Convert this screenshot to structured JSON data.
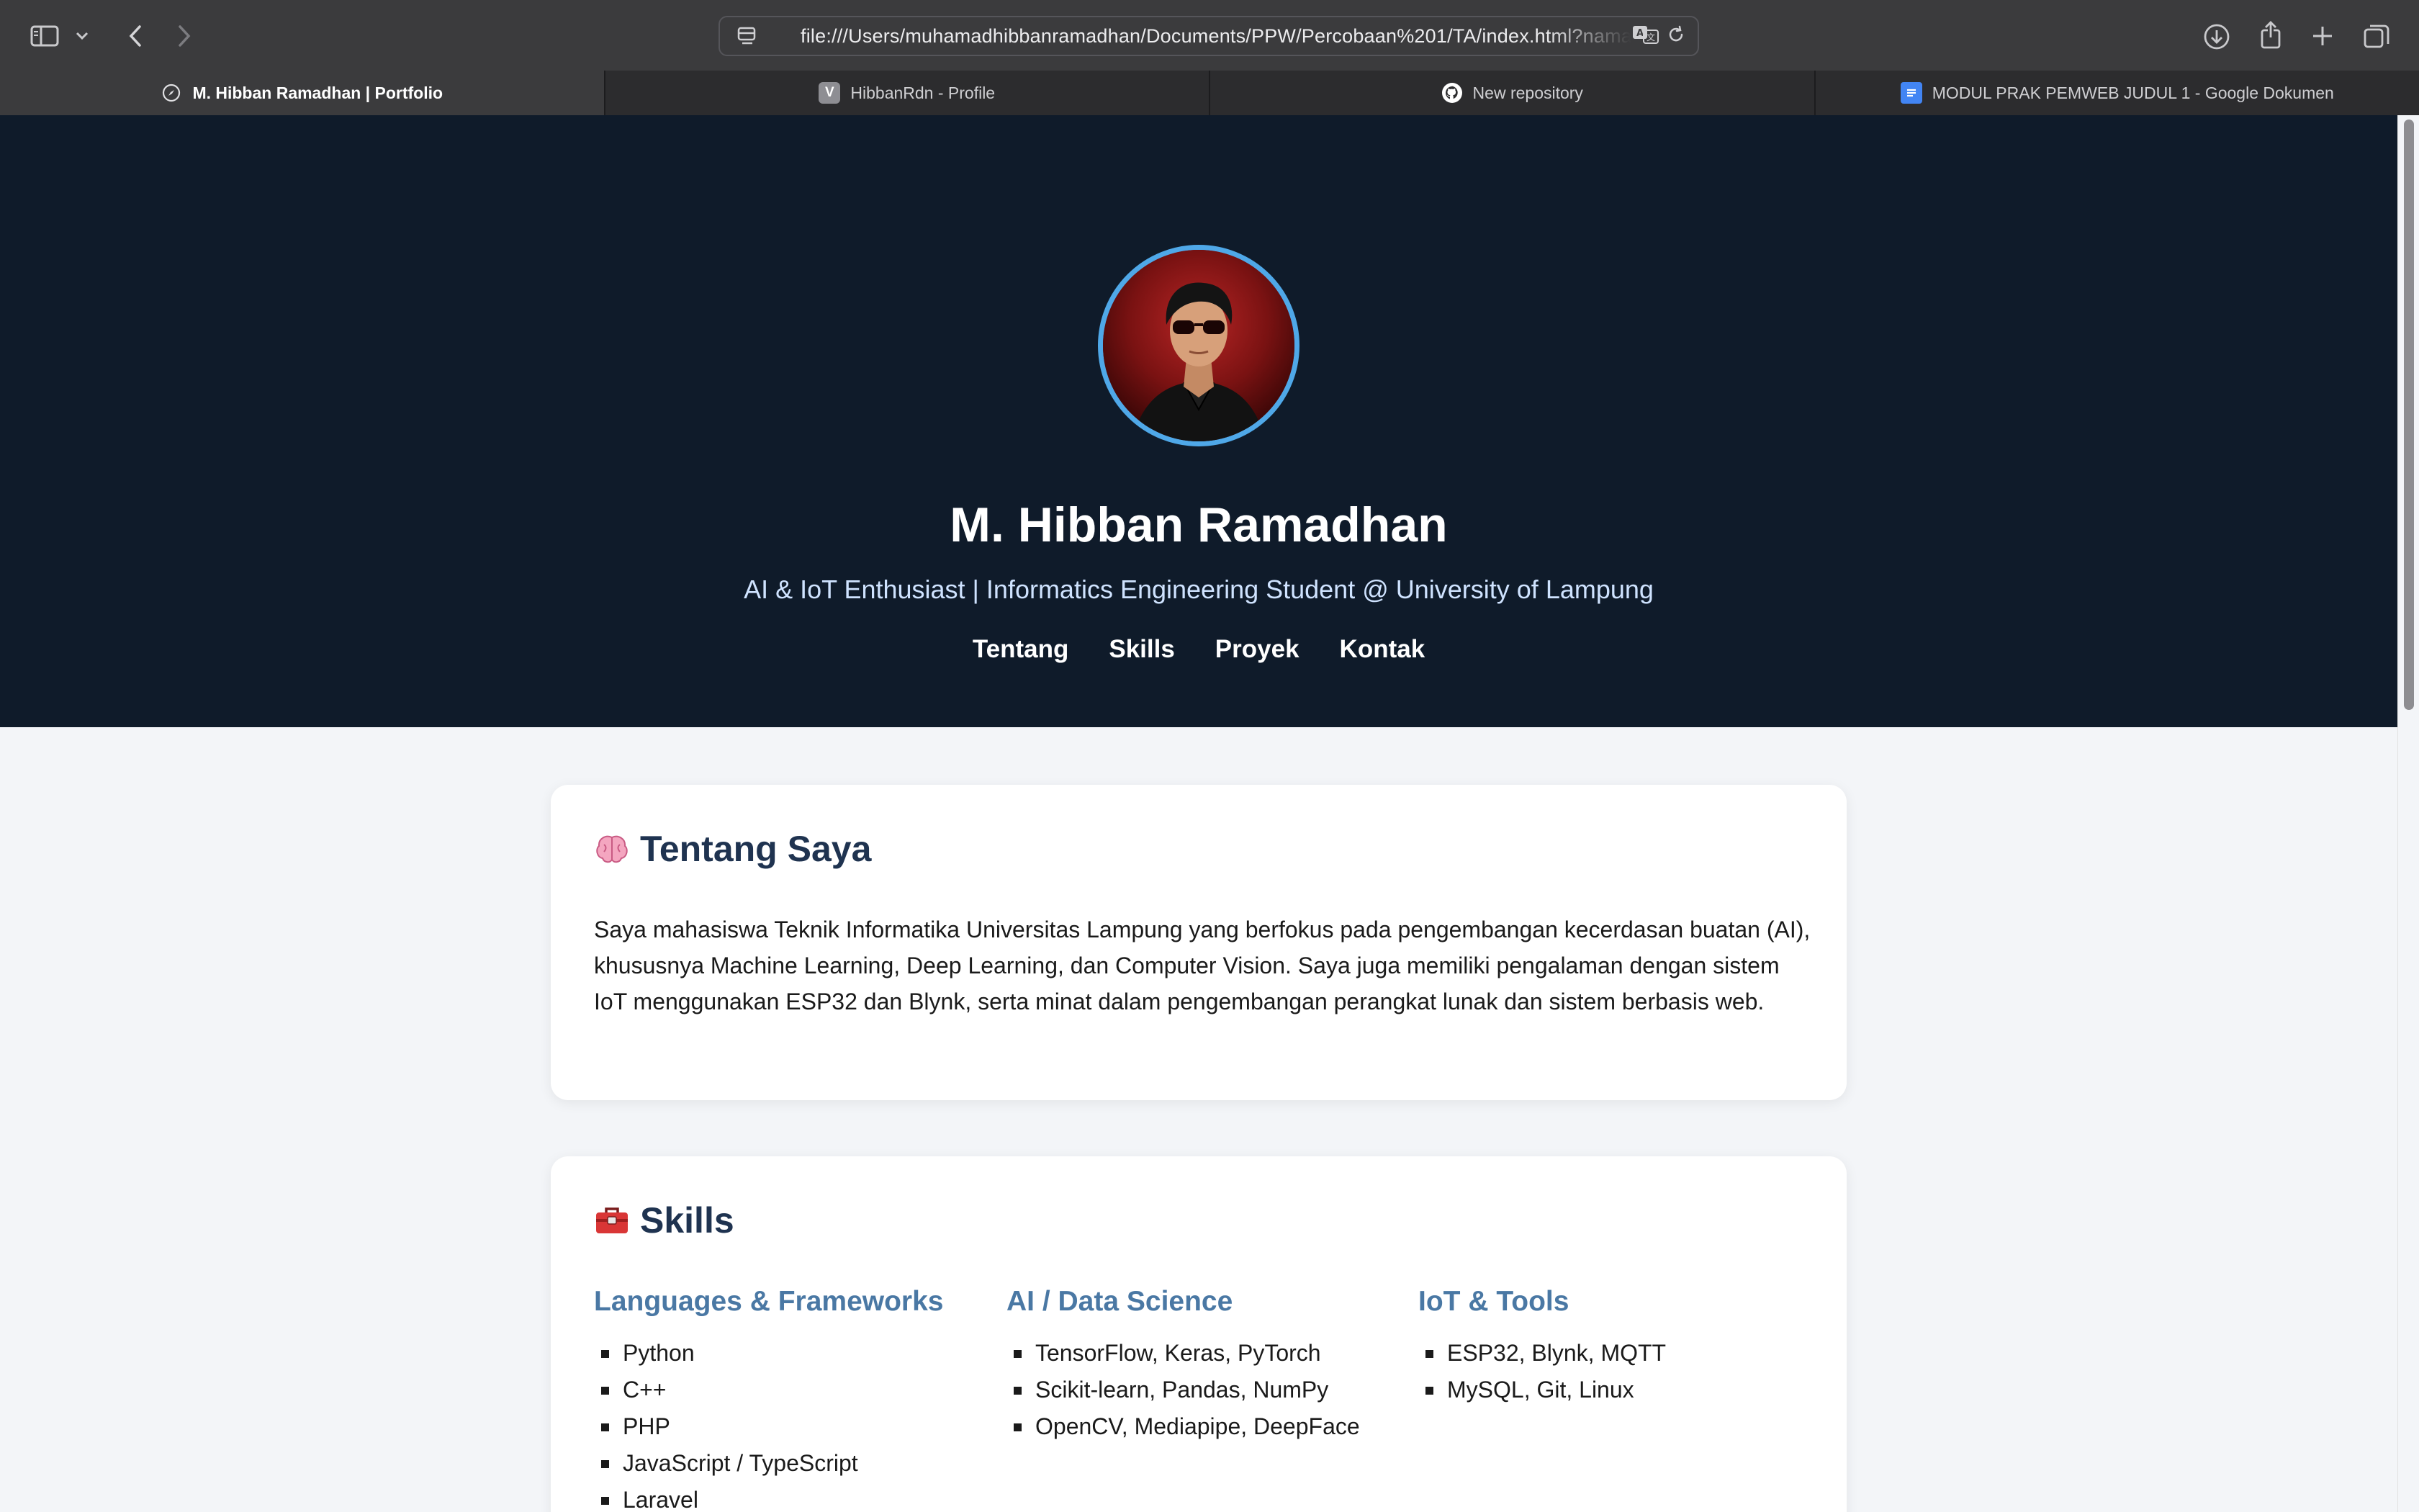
{
  "browser": {
    "url": "file:///Users/muhamadhibbanramadhan/Documents/PPW/Percobaan%201/TA/index.html?nama=",
    "tabs": [
      {
        "title": "M. Hibban Ramadhan | Portfolio",
        "icon": "compass-icon"
      },
      {
        "title": "HibbanRdn - Profile",
        "icon": "v-favicon",
        "favicon_letter": "V"
      },
      {
        "title": "New repository",
        "icon": "github-icon"
      },
      {
        "title": "MODUL PRAK PEMWEB JUDUL 1 - Google Dokumen",
        "icon": "google-docs-icon"
      }
    ]
  },
  "hero": {
    "name": "M. Hibban Ramadhan",
    "tagline": "AI & IoT Enthusiast | Informatics Engineering Student @ University of Lampung",
    "nav": [
      "Tentang",
      "Skills",
      "Proyek",
      "Kontak"
    ]
  },
  "about": {
    "title": "Tentang Saya",
    "icon": "brain-icon",
    "text": "Saya mahasiswa Teknik Informatika Universitas Lampung yang berfokus pada pengembangan kecerdasan buatan (AI), khususnya Machine Learning, Deep Learning, dan Computer Vision. Saya juga memiliki pengalaman dengan sistem IoT menggunakan ESP32 dan Blynk, serta minat dalam pengembangan perangkat lunak dan sistem berbasis web."
  },
  "skills": {
    "title": "Skills",
    "icon": "toolbox-icon",
    "columns": [
      {
        "heading": "Languages & Frameworks",
        "items": [
          "Python",
          "C++",
          "PHP",
          "JavaScript / TypeScript",
          "Laravel"
        ]
      },
      {
        "heading": "AI / Data Science",
        "items": [
          "TensorFlow, Keras, PyTorch",
          "Scikit-learn, Pandas, NumPy",
          "OpenCV, Mediapipe, DeepFace"
        ]
      },
      {
        "heading": "IoT & Tools",
        "items": [
          "ESP32, Blynk, MQTT",
          "MySQL, Git, Linux"
        ]
      }
    ]
  },
  "colors": {
    "hero_bg": "#0f1b2a",
    "avatar_ring": "#4fa8e8",
    "card_title": "#1f3350",
    "skill_heading": "#4a78a4"
  }
}
